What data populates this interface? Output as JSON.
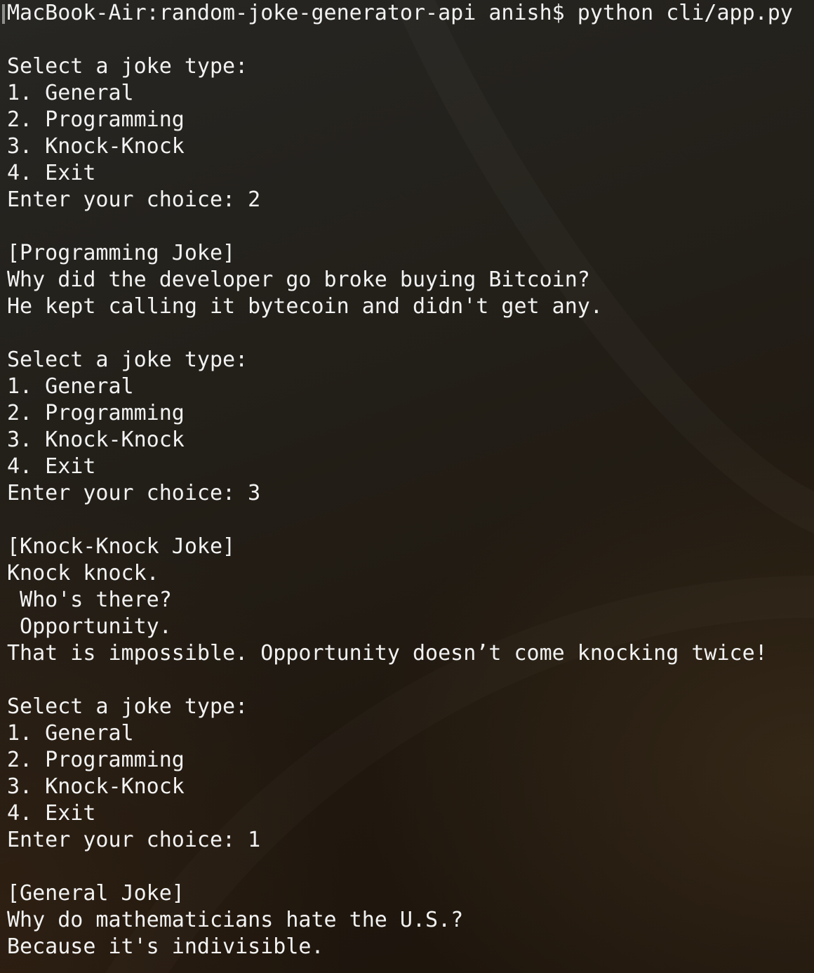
{
  "terminal": {
    "prompt_line": "MacBook-Air:random-joke-generator-api anish$ python cli/app.py",
    "lines": [
      "",
      "Select a joke type:",
      "1. General",
      "2. Programming",
      "3. Knock-Knock",
      "4. Exit",
      "Enter your choice: 2",
      "",
      "[Programming Joke]",
      "Why did the developer go broke buying Bitcoin?",
      "He kept calling it bytecoin and didn't get any.",
      "",
      "Select a joke type:",
      "1. General",
      "2. Programming",
      "3. Knock-Knock",
      "4. Exit",
      "Enter your choice: 3",
      "",
      "[Knock-Knock Joke]",
      "Knock knock.",
      " Who's there?",
      " Opportunity.",
      "That is impossible. Opportunity doesn’t come knocking twice!",
      "",
      "Select a joke type:",
      "1. General",
      "2. Programming",
      "3. Knock-Knock",
      "4. Exit",
      "Enter your choice: 1",
      "",
      "[General Joke]",
      "Why do mathematicians hate the U.S.?",
      "Because it's indivisible."
    ]
  },
  "colors": {
    "text": "#f2f2f2",
    "background": "#221b14"
  }
}
